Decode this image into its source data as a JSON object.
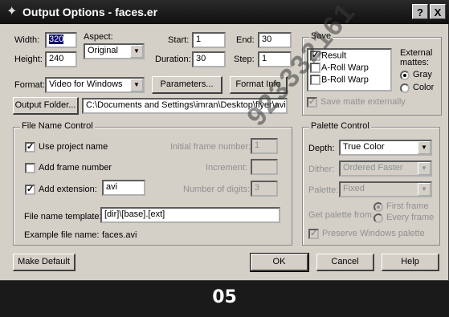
{
  "window": {
    "title": "Output Options - faces.er",
    "help_glyph": "?",
    "close_glyph": "X"
  },
  "size": {
    "width_label": "Width:",
    "width_value": "320",
    "height_label": "Height:",
    "height_value": "240",
    "aspect_label": "Aspect:",
    "aspect_value": "Original"
  },
  "range": {
    "start_label": "Start:",
    "start_value": "1",
    "end_label": "End:",
    "end_value": "30",
    "duration_label": "Duration:",
    "duration_value": "30",
    "step_label": "Step:",
    "step_value": "1"
  },
  "format": {
    "label": "Format:",
    "value": "Video for Windows",
    "parameters_button": "Parameters...",
    "info_button": "Format Info",
    "folder_button": "Output Folder...",
    "folder_value": "C:\\Documents and Settings\\imran\\Desktop\\flyer\\avi"
  },
  "save": {
    "group_label": "Save",
    "items": [
      {
        "label": "Result",
        "checked": "✓"
      },
      {
        "label": "A-Roll Warp",
        "checked": ""
      },
      {
        "label": "B-Roll Warp",
        "checked": ""
      }
    ],
    "external_label": "External",
    "mattes_label": "mattes:",
    "gray_label": "Gray",
    "color_label": "Color",
    "save_matte_label": "Save matte externally",
    "save_matte_checked": "✓"
  },
  "file_name_control": {
    "group_label": "File Name Control",
    "use_project_label": "Use project name",
    "use_project_checked": "✓",
    "add_frame_label": "Add frame number",
    "add_frame_checked": "",
    "add_ext_label": "Add extension:",
    "add_ext_checked": "✓",
    "ext_value": "avi",
    "initial_frame_label": "Initial frame number:",
    "initial_frame_value": "1",
    "increment_label": "Increment:",
    "increment_value": "",
    "digits_label": "Number of digits:",
    "digits_value": "3",
    "template_label": "File name template:",
    "template_value": "[dir]\\[base].[ext]",
    "example_label": "Example file name:",
    "example_value": "faces.avi"
  },
  "palette_control": {
    "group_label": "Palette Control",
    "depth_label": "Depth:",
    "depth_value": "True Color",
    "dither_label": "Dither:",
    "dither_value": "Ordered Faster",
    "palette_label": "Palette:",
    "palette_value": "Fixed",
    "get_from_label": "Get palette from:",
    "first_frame_label": "First frame",
    "every_frame_label": "Every frame",
    "preserve_label": "Preserve Windows palette",
    "preserve_checked": "✓"
  },
  "buttons": {
    "make_default": "Make Default",
    "ok": "OK",
    "cancel": "Cancel",
    "help": "Help"
  },
  "footer": {
    "page_number": "05"
  },
  "watermark": "923332161"
}
